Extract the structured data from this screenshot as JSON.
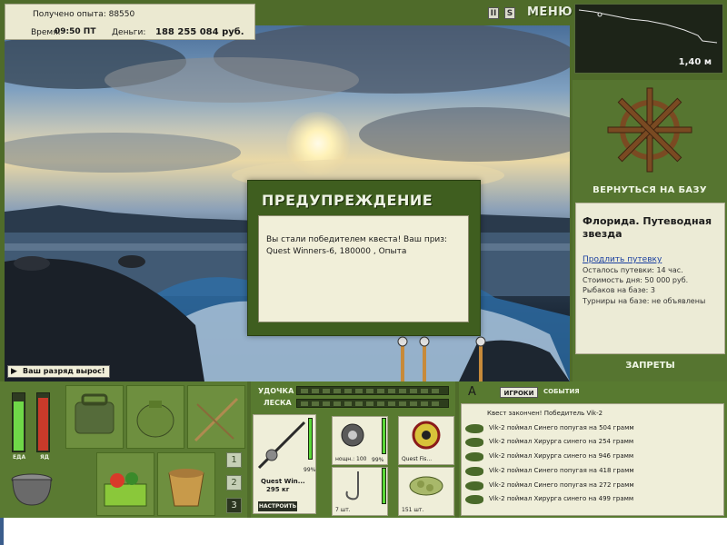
{
  "info": {
    "experience_label": "Получено опыта: 88550",
    "time_label": "Время:",
    "time_value": "09:50 ПТ",
    "money_label": "Деньги:",
    "money_value": "188 255 084 руб."
  },
  "controls": {
    "pause": "II",
    "sound": "S",
    "menu": "МЕНЮ"
  },
  "depth": {
    "value": "1,40 м"
  },
  "right_panel": {
    "return_to_base": "ВЕРНУТЬСЯ НА БАЗУ",
    "location_title": "Флорида. Путеводная звезда",
    "extend_permit": "Продлить путевку",
    "permit_left": "Осталось путевки: 14 час.",
    "day_cost": "Стоимость дня: 50 000 руб.",
    "anglers": "Рыбаков на базе: 3",
    "tournaments": "Турниры на базе: не объявлены",
    "bans": "ЗАПРЕТЫ"
  },
  "dialog": {
    "title": "ПРЕДУПРЕЖДЕНИЕ",
    "message": "Вы стали победителем квеста! Ваш приз: Quest Winners-6, 180000 , Опыта"
  },
  "achievement": {
    "text": "Ваш разряд вырос!"
  },
  "meters": {
    "food_label": "ЕДА",
    "poison_label": "ЯД",
    "food_level": 0.85,
    "poison_level": 0.9
  },
  "levels": [
    "1",
    "2",
    "3"
  ],
  "tackle": {
    "rod_label": "УДОЧКА",
    "line_label": "ЛЕСКА",
    "rod_name": "Quest Win...",
    "rod_weight": "295 кг",
    "rod_percent": "99%",
    "setup": "НАСТРОИТЬ",
    "reel_caption": "нощн.: 100",
    "reel_percent": "99%",
    "line_caption": "Quest Fis...",
    "hook_caption": "7 шт.",
    "bait_caption": "151 шт."
  },
  "log": {
    "compass": "A",
    "tab_players": "ИГРОКИ",
    "tab_events": "СОБЫТИЯ",
    "header": "Квест закончен! Победитель Vik-2",
    "rows": [
      "Vik-2 поймал Синего попугая на 504 грамм",
      "Vik-2 поймал Хирурга синего на 254 грамм",
      "Vik-2 поймал Хирурга синего на 946 грамм",
      "Vik-2 поймал Синего попугая на 418 грамм",
      "Vik-2 поймал Синего попугая на 272 грамм",
      "Vik-2 поймал Хирурга синего на 499 грамм"
    ]
  }
}
